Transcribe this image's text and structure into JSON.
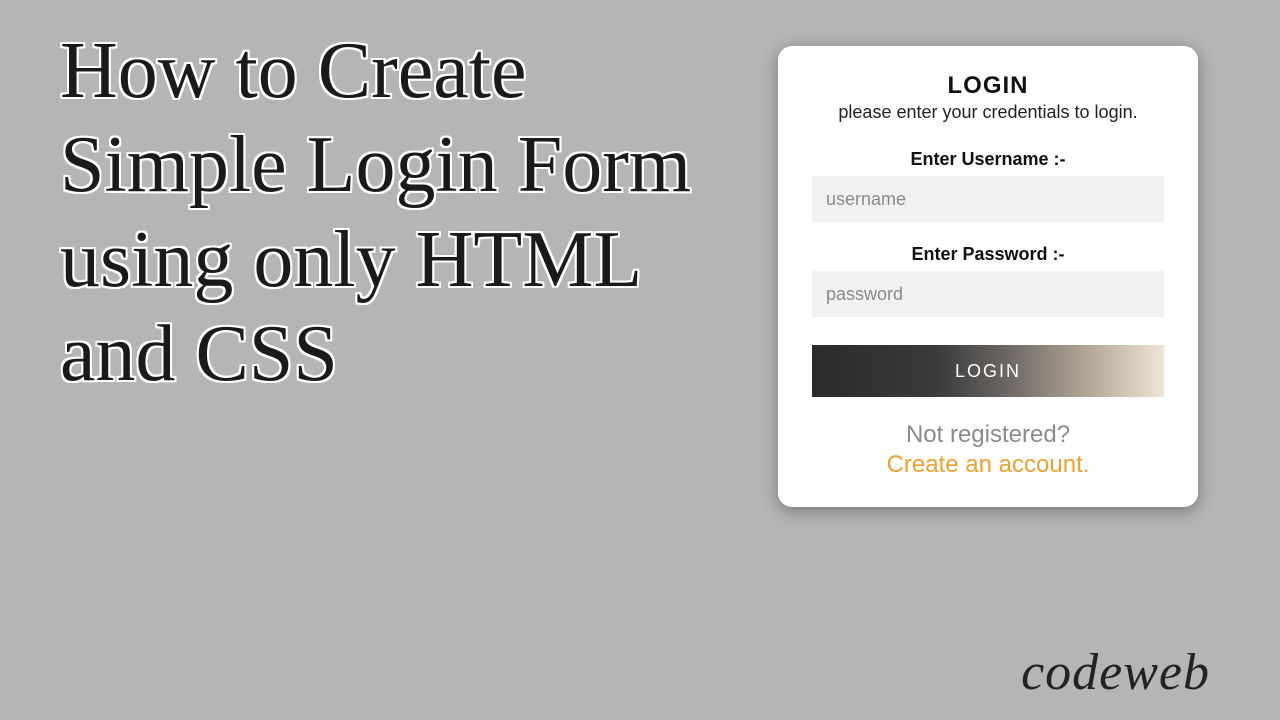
{
  "headline": "How to Create Simple Login Form using only HTML and CSS",
  "brand": "codeweb",
  "card": {
    "title": "LOGIN",
    "subtitle": "please enter your credentials to login.",
    "username_label": "Enter Username :-",
    "username_placeholder": "username",
    "password_label": "Enter Password :-",
    "password_placeholder": "password",
    "button_label": "LOGIN",
    "not_registered": "Not registered?",
    "create_account": "Create an account."
  }
}
